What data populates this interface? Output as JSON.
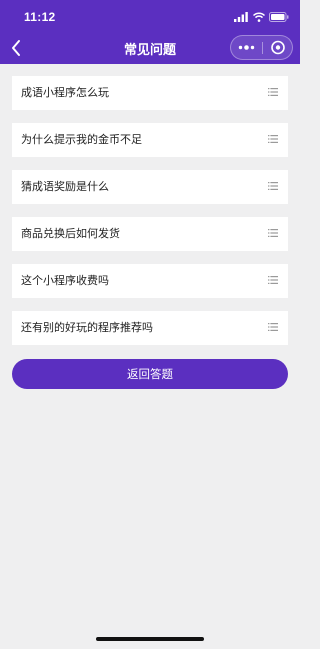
{
  "status_bar": {
    "time": "11:12"
  },
  "nav": {
    "title": "常见问题",
    "back_icon": "chevron-left-icon",
    "more_icon": "more-dots-icon",
    "close_icon": "target-circle-icon"
  },
  "faq": {
    "items": [
      {
        "text": "成语小程序怎么玩"
      },
      {
        "text": "为什么提示我的金币不足"
      },
      {
        "text": "猜成语奖励是什么"
      },
      {
        "text": "商品兑换后如何发货"
      },
      {
        "text": "这个小程序收费吗"
      },
      {
        "text": "还有别的好玩的程序推荐吗"
      }
    ],
    "item_icon": "list-lines-icon"
  },
  "return_button": {
    "label": "返回答题"
  },
  "colors": {
    "brand_purple": "#5b2fc0",
    "page_background": "#efeff0",
    "item_background": "#ffffff",
    "text": "#222222",
    "icon_gray": "#9a9a9a"
  }
}
